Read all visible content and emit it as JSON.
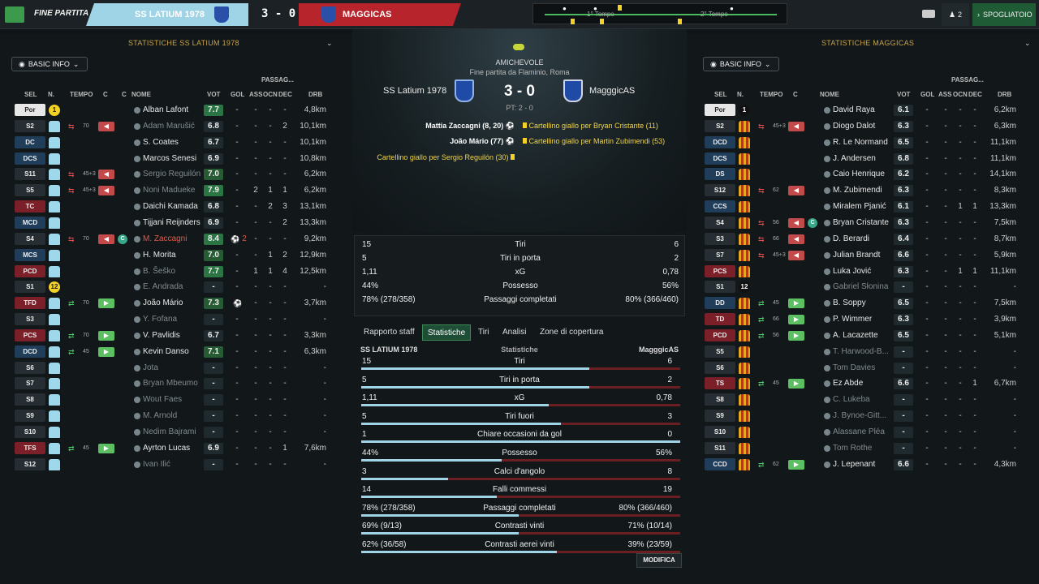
{
  "top": {
    "match_state": "Fine partita",
    "home_team": "SS LATIUM 1978",
    "score": "3 - 0",
    "away_team": "MAGGICAS",
    "timeline_h1": "1° Tempo",
    "timeline_h2": "2° Tempo",
    "subs_count": "2",
    "dressing_room": "SPOGLIATOIO"
  },
  "home_panel": {
    "title": "STATISTICHE SS LATIUM 1978",
    "basic_info": "BASIC INFO",
    "headers": {
      "sel": "SEL",
      "n": "N.",
      "tempo": "TEMPO",
      "c": "C",
      "c2": "C",
      "nome": "NOME",
      "passag": "PASSAG...",
      "vot": "VOT",
      "gol": "GOL",
      "ass": "ASS",
      "ocn": "OCN",
      "dec": "DEC",
      "drb": "DRB"
    },
    "players": [
      {
        "pos": "Por",
        "n": "1",
        "tempo": "",
        "name": "Alban Lafont",
        "vot": "7.7",
        "gol": "-",
        "ass": "-",
        "ocn": "-",
        "dec": "-",
        "drb": "4,8km"
      },
      {
        "pos": "S2",
        "n": "",
        "tempo": "70",
        "name": "Adam Marušić",
        "vot": "6.8",
        "gol": "-",
        "ass": "-",
        "ocn": "-",
        "dec": "2",
        "drb": "10,1km"
      },
      {
        "pos": "DC",
        "n": "",
        "tempo": "",
        "name": "S. Coates",
        "vot": "6.7",
        "gol": "-",
        "ass": "-",
        "ocn": "-",
        "dec": "-",
        "drb": "10,1km"
      },
      {
        "pos": "DCS",
        "n": "",
        "tempo": "",
        "name": "Marcos Senesi",
        "vot": "6.9",
        "gol": "-",
        "ass": "-",
        "ocn": "-",
        "dec": "-",
        "drb": "10,8km"
      },
      {
        "pos": "S11",
        "n": "",
        "tempo": "45+3",
        "name": "Sergio Reguilón",
        "vot": "7.0",
        "gol": "-",
        "ass": "-",
        "ocn": "-",
        "dec": "-",
        "drb": "6,2km"
      },
      {
        "pos": "S5",
        "n": "",
        "tempo": "45+3",
        "name": "Noni Madueke",
        "vot": "7.9",
        "gol": "-",
        "ass": "2",
        "ocn": "1",
        "dec": "1",
        "drb": "6,2km"
      },
      {
        "pos": "TC",
        "n": "",
        "tempo": "",
        "name": "Daichi Kamada",
        "vot": "6.8",
        "gol": "-",
        "ass": "-",
        "ocn": "2",
        "dec": "3",
        "drb": "13,1km"
      },
      {
        "pos": "MCD",
        "n": "",
        "tempo": "",
        "name": "Tijjani Reijnders",
        "vot": "6.9",
        "gol": "-",
        "ass": "-",
        "ocn": "-",
        "dec": "2",
        "drb": "13,3km"
      },
      {
        "pos": "S4",
        "n": "",
        "tempo": "70",
        "name": "M. Zaccagni",
        "vot": "8.4",
        "gol": "2",
        "ass": "-",
        "ocn": "-",
        "dec": "-",
        "drb": "9,2km"
      },
      {
        "pos": "MCS",
        "n": "",
        "tempo": "",
        "name": "H. Morita",
        "vot": "7.0",
        "gol": "-",
        "ass": "-",
        "ocn": "1",
        "dec": "2",
        "drb": "12,9km"
      },
      {
        "pos": "PCD",
        "n": "",
        "tempo": "",
        "name": "B. Šeško",
        "vot": "7.7",
        "gol": "-",
        "ass": "1",
        "ocn": "1",
        "dec": "4",
        "drb": "12,5km"
      },
      {
        "pos": "S1",
        "n": "12",
        "tempo": "",
        "name": "E. Andrada",
        "vot": "-",
        "gol": "-",
        "ass": "-",
        "ocn": "-",
        "dec": "-",
        "drb": "-"
      },
      {
        "pos": "TFD",
        "n": "",
        "tempo": "70",
        "name": "João Mário",
        "vot": "7.3",
        "gol": "",
        "ass": "-",
        "ocn": "-",
        "dec": "-",
        "drb": "3,7km"
      },
      {
        "pos": "S3",
        "n": "",
        "tempo": "",
        "name": "Y. Fofana",
        "vot": "-",
        "gol": "-",
        "ass": "-",
        "ocn": "-",
        "dec": "-",
        "drb": "-"
      },
      {
        "pos": "PCS",
        "n": "",
        "tempo": "70",
        "name": "V. Pavlidis",
        "vot": "6.7",
        "gol": "-",
        "ass": "-",
        "ocn": "-",
        "dec": "-",
        "drb": "3,3km"
      },
      {
        "pos": "DCD",
        "n": "",
        "tempo": "45",
        "name": "Kevin Danso",
        "vot": "7.1",
        "gol": "-",
        "ass": "-",
        "ocn": "-",
        "dec": "-",
        "drb": "6,3km"
      },
      {
        "pos": "S6",
        "n": "",
        "tempo": "",
        "name": "Jota",
        "vot": "-",
        "gol": "-",
        "ass": "-",
        "ocn": "-",
        "dec": "-",
        "drb": "-"
      },
      {
        "pos": "S7",
        "n": "",
        "tempo": "",
        "name": "Bryan Mbeumo",
        "vot": "-",
        "gol": "-",
        "ass": "-",
        "ocn": "-",
        "dec": "-",
        "drb": "-"
      },
      {
        "pos": "S8",
        "n": "",
        "tempo": "",
        "name": "Wout Faes",
        "vot": "-",
        "gol": "-",
        "ass": "-",
        "ocn": "-",
        "dec": "-",
        "drb": "-"
      },
      {
        "pos": "S9",
        "n": "",
        "tempo": "",
        "name": "M. Arnold",
        "vot": "-",
        "gol": "-",
        "ass": "-",
        "ocn": "-",
        "dec": "-",
        "drb": "-"
      },
      {
        "pos": "S10",
        "n": "",
        "tempo": "",
        "name": "Nedim Bajrami",
        "vot": "-",
        "gol": "-",
        "ass": "-",
        "ocn": "-",
        "dec": "-",
        "drb": "-"
      },
      {
        "pos": "TFS",
        "n": "",
        "tempo": "45",
        "name": "Ayrton Lucas",
        "vot": "6.9",
        "gol": "-",
        "ass": "-",
        "ocn": "-",
        "dec": "1",
        "drb": "7,6km"
      },
      {
        "pos": "S12",
        "n": "",
        "tempo": "",
        "name": "Ivan Ilić",
        "vot": "-",
        "gol": "-",
        "ass": "-",
        "ocn": "-",
        "dec": "-",
        "drb": "-"
      }
    ]
  },
  "away_panel": {
    "title": "STATISTICHE MAGGICAS",
    "basic_info": "BASIC INFO",
    "headers": {
      "sel": "SEL",
      "n": "N.",
      "tempo": "TEMPO",
      "c": "C",
      "nome": "NOME",
      "passag": "PASSAG...",
      "vot": "VOT",
      "gol": "GOL",
      "ass": "ASS",
      "ocn": "OCN",
      "dec": "DEC",
      "drb": "DRB"
    },
    "players": [
      {
        "pos": "Por",
        "n": "1",
        "tempo": "",
        "name": "David Raya",
        "vot": "6.1",
        "gol": "-",
        "ass": "-",
        "ocn": "-",
        "dec": "-",
        "drb": "6,2km"
      },
      {
        "pos": "S2",
        "n": "",
        "tempo": "45+3",
        "name": "Diogo Dalot",
        "vot": "6.3",
        "gol": "-",
        "ass": "-",
        "ocn": "-",
        "dec": "-",
        "drb": "6,3km"
      },
      {
        "pos": "DCD",
        "n": "",
        "tempo": "",
        "name": "R. Le Normand",
        "vot": "6.5",
        "gol": "-",
        "ass": "-",
        "ocn": "-",
        "dec": "-",
        "drb": "11,1km"
      },
      {
        "pos": "DCS",
        "n": "",
        "tempo": "",
        "name": "J. Andersen",
        "vot": "6.8",
        "gol": "-",
        "ass": "-",
        "ocn": "-",
        "dec": "-",
        "drb": "11,1km"
      },
      {
        "pos": "DS",
        "n": "",
        "tempo": "",
        "name": "Caio Henrique",
        "vot": "6.2",
        "gol": "-",
        "ass": "-",
        "ocn": "-",
        "dec": "-",
        "drb": "14,1km"
      },
      {
        "pos": "S12",
        "n": "",
        "tempo": "62",
        "name": "M. Zubimendi",
        "vot": "6.3",
        "gol": "-",
        "ass": "-",
        "ocn": "-",
        "dec": "-",
        "drb": "8,3km"
      },
      {
        "pos": "CCS",
        "n": "",
        "tempo": "",
        "name": "Miralem Pjanić",
        "vot": "6.1",
        "gol": "-",
        "ass": "-",
        "ocn": "1",
        "dec": "1",
        "drb": "13,3km"
      },
      {
        "pos": "S4",
        "n": "",
        "tempo": "56",
        "name": "Bryan Cristante",
        "vot": "6.3",
        "gol": "-",
        "ass": "-",
        "ocn": "-",
        "dec": "-",
        "drb": "7,5km"
      },
      {
        "pos": "S3",
        "n": "",
        "tempo": "66",
        "name": "D. Berardi",
        "vot": "6.4",
        "gol": "-",
        "ass": "-",
        "ocn": "-",
        "dec": "-",
        "drb": "8,7km"
      },
      {
        "pos": "S7",
        "n": "",
        "tempo": "45+3",
        "name": "Julian Brandt",
        "vot": "6.6",
        "gol": "-",
        "ass": "-",
        "ocn": "-",
        "dec": "-",
        "drb": "5,9km"
      },
      {
        "pos": "PCS",
        "n": "",
        "tempo": "",
        "name": "Luka Jović",
        "vot": "6.3",
        "gol": "-",
        "ass": "-",
        "ocn": "1",
        "dec": "1",
        "drb": "11,1km"
      },
      {
        "pos": "S1",
        "n": "12",
        "tempo": "",
        "name": "Gabriel Słonina",
        "vot": "-",
        "gol": "-",
        "ass": "-",
        "ocn": "-",
        "dec": "-",
        "drb": "-"
      },
      {
        "pos": "DD",
        "n": "",
        "tempo": "45",
        "name": "B. Soppy",
        "vot": "6.5",
        "gol": "-",
        "ass": "-",
        "ocn": "-",
        "dec": "-",
        "drb": "7,5km"
      },
      {
        "pos": "TD",
        "n": "",
        "tempo": "66",
        "name": "P. Wimmer",
        "vot": "6.3",
        "gol": "-",
        "ass": "-",
        "ocn": "-",
        "dec": "-",
        "drb": "3,9km"
      },
      {
        "pos": "PCD",
        "n": "",
        "tempo": "56",
        "name": "A. Lacazette",
        "vot": "6.5",
        "gol": "-",
        "ass": "-",
        "ocn": "-",
        "dec": "-",
        "drb": "5,1km"
      },
      {
        "pos": "S5",
        "n": "",
        "tempo": "",
        "name": "T. Harwood-B...",
        "vot": "-",
        "gol": "-",
        "ass": "-",
        "ocn": "-",
        "dec": "-",
        "drb": "-"
      },
      {
        "pos": "S6",
        "n": "",
        "tempo": "",
        "name": "Tom Davies",
        "vot": "-",
        "gol": "-",
        "ass": "-",
        "ocn": "-",
        "dec": "-",
        "drb": "-"
      },
      {
        "pos": "TS",
        "n": "",
        "tempo": "45",
        "name": "Ez Abde",
        "vot": "6.6",
        "gol": "-",
        "ass": "-",
        "ocn": "-",
        "dec": "1",
        "drb": "6,7km"
      },
      {
        "pos": "S8",
        "n": "",
        "tempo": "",
        "name": "C. Lukeba",
        "vot": "-",
        "gol": "-",
        "ass": "-",
        "ocn": "-",
        "dec": "-",
        "drb": "-"
      },
      {
        "pos": "S9",
        "n": "",
        "tempo": "",
        "name": "J. Bynoe-Gitt...",
        "vot": "-",
        "gol": "-",
        "ass": "-",
        "ocn": "-",
        "dec": "-",
        "drb": "-"
      },
      {
        "pos": "S10",
        "n": "",
        "tempo": "",
        "name": "Alassane Pléa",
        "vot": "-",
        "gol": "-",
        "ass": "-",
        "ocn": "-",
        "dec": "-",
        "drb": "-"
      },
      {
        "pos": "S11",
        "n": "",
        "tempo": "",
        "name": "Tom Rothe",
        "vot": "-",
        "gol": "-",
        "ass": "-",
        "ocn": "-",
        "dec": "-",
        "drb": "-"
      },
      {
        "pos": "CCD",
        "n": "",
        "tempo": "62",
        "name": "J. Lepenant",
        "vot": "6.6",
        "gol": "-",
        "ass": "-",
        "ocn": "-",
        "dec": "-",
        "drb": "4,3km"
      }
    ]
  },
  "match": {
    "competition": "AMICHEVOLE",
    "venue": "Fine partita da Flaminio, Roma",
    "home": "SS Latium 1978",
    "away": "MagggicAS",
    "score": "3 - 0",
    "ht": "PT: 2 - 0",
    "events_home": [
      "Mattia Zaccagni (8, 20)",
      "João Mário (77)",
      "Cartellino giallo per Sergio Reguilón (30)"
    ],
    "events_away": [
      "Cartellino giallo per Bryan Cristante (11)",
      "Cartellino giallo per Martin Zubimendi (53)"
    ]
  },
  "summary": [
    {
      "h": "15",
      "label": "Tiri",
      "a": "6"
    },
    {
      "h": "5",
      "label": "Tiri in porta",
      "a": "2"
    },
    {
      "h": "1,11",
      "label": "xG",
      "a": "0,78"
    },
    {
      "h": "44%",
      "label": "Possesso",
      "a": "56%"
    },
    {
      "h": "78% (278/358)",
      "label": "Passaggi completati",
      "a": "80% (366/460)"
    }
  ],
  "tabs": [
    "Rapporto staff",
    "Statistiche",
    "Tiri",
    "Analisi",
    "Zone di copertura"
  ],
  "stats_header": {
    "home": "SS Latium 1978",
    "mid": "Statistiche",
    "away": "MagggicAS"
  },
  "stats": [
    {
      "h": "15",
      "label": "Tiri",
      "a": "6",
      "frac": 0.714
    },
    {
      "h": "5",
      "label": "Tiri in porta",
      "a": "2",
      "frac": 0.714
    },
    {
      "h": "1,11",
      "label": "xG",
      "a": "0,78",
      "frac": 0.587
    },
    {
      "h": "5",
      "label": "Tiri fuori",
      "a": "3",
      "frac": 0.625
    },
    {
      "h": "1",
      "label": "Chiare occasioni da gol",
      "a": "0",
      "frac": 1.0
    },
    {
      "h": "44%",
      "label": "Possesso",
      "a": "56%",
      "frac": 0.44
    },
    {
      "h": "3",
      "label": "Calci d'angolo",
      "a": "8",
      "frac": 0.273
    },
    {
      "h": "14",
      "label": "Falli commessi",
      "a": "19",
      "frac": 0.424
    },
    {
      "h": "78% (278/358)",
      "label": "Passaggi completati",
      "a": "80% (366/460)",
      "frac": 0.494
    },
    {
      "h": "69% (9/13)",
      "label": "Contrasti vinti",
      "a": "71% (10/14)",
      "frac": 0.493
    },
    {
      "h": "62% (36/58)",
      "label": "Contrasti aerei vinti",
      "a": "39% (23/59)",
      "frac": 0.614
    }
  ],
  "modify": "MODIFICA"
}
